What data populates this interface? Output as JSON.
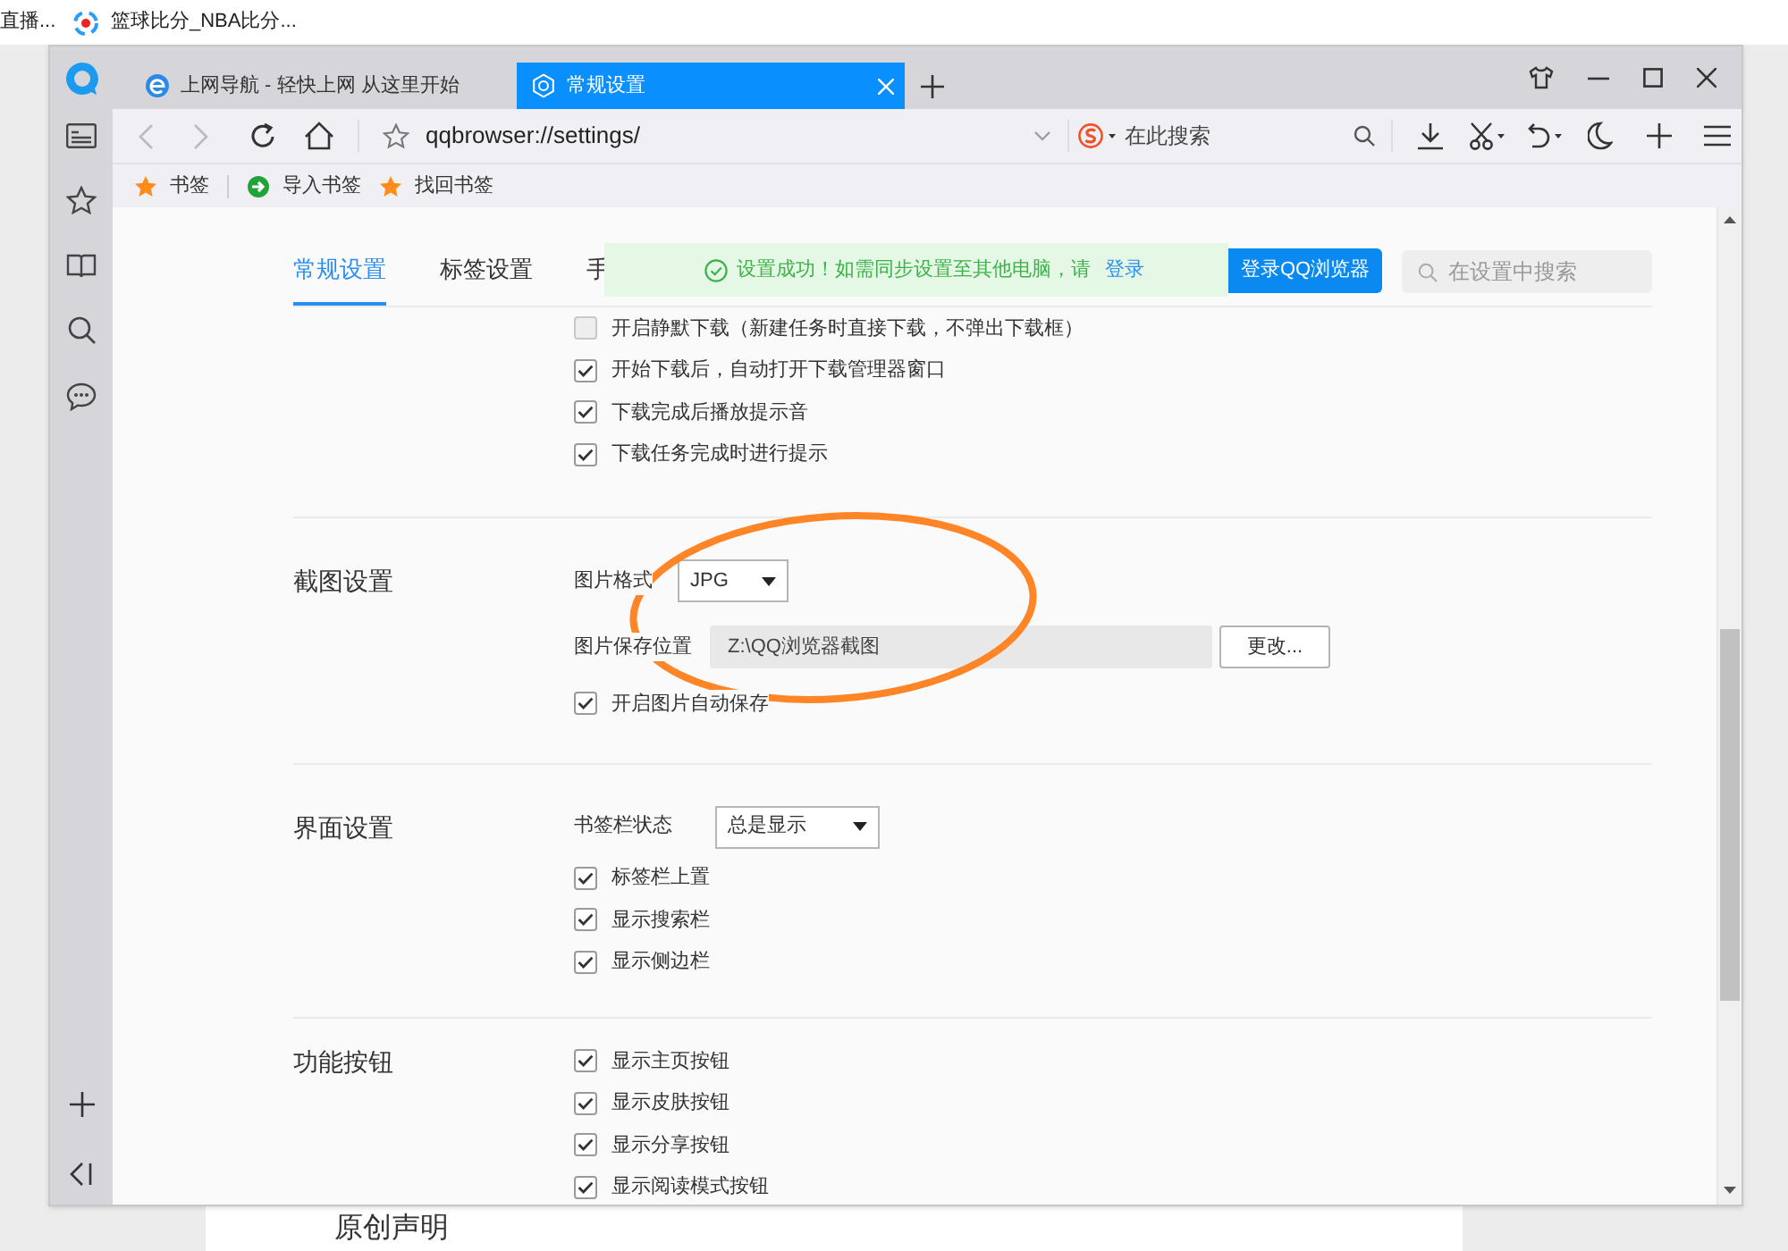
{
  "background_page": {
    "tabs": [
      {
        "title": "直播..."
      },
      {
        "title": "篮球比分_NBA比分..."
      }
    ],
    "footer_heading": "原创声明"
  },
  "browser": {
    "tabs": [
      {
        "title": "上网导航 - 轻快上网 从这里开始",
        "selected": false,
        "kind": "web"
      },
      {
        "title": "常规设置",
        "selected": true,
        "kind": "settings"
      }
    ],
    "address": "qqbrowser://settings/",
    "search_placeholder": "在此搜索",
    "bookmarks": [
      {
        "label": "书签",
        "kind": "star"
      },
      {
        "label": "导入书签",
        "kind": "import"
      },
      {
        "label": "找回书签",
        "kind": "star"
      }
    ]
  },
  "settings": {
    "tabs": [
      {
        "label": "常规设置",
        "selected": true
      },
      {
        "label": "标签设置",
        "selected": false
      },
      {
        "label": "手",
        "selected": false
      }
    ],
    "notice": {
      "text": "设置成功！如需同步设置至其他电脑，请",
      "link": "登录"
    },
    "login_button": "登录QQ浏览器",
    "search_placeholder": "在设置中搜索",
    "sections": [
      {
        "items": [
          {
            "kind": "checkbox",
            "label": "开启静默下载（新建任务时直接下载，不弹出下载框）",
            "checked": false
          },
          {
            "kind": "checkbox",
            "label": "开始下载后，自动打开下载管理器窗口",
            "checked": true
          },
          {
            "kind": "checkbox",
            "label": "下载完成后播放提示音",
            "checked": true
          },
          {
            "kind": "checkbox",
            "label": "下载任务完成时进行提示",
            "checked": true
          }
        ]
      },
      {
        "title": "截图设置",
        "items": [
          {
            "kind": "select",
            "label": "图片格式",
            "value": "JPG"
          },
          {
            "kind": "path",
            "label": "图片保存位置",
            "value": "Z:\\QQ浏览器截图",
            "button": "更改..."
          },
          {
            "kind": "checkbox",
            "label": "开启图片自动保存",
            "checked": true
          }
        ]
      },
      {
        "title": "界面设置",
        "items": [
          {
            "kind": "select",
            "label": "书签栏状态",
            "value": "总是显示"
          },
          {
            "kind": "checkbox",
            "label": "标签栏上置",
            "checked": true
          },
          {
            "kind": "checkbox",
            "label": "显示搜索栏",
            "checked": true
          },
          {
            "kind": "checkbox",
            "label": "显示侧边栏",
            "checked": true
          }
        ]
      },
      {
        "title": "功能按钮",
        "items": [
          {
            "kind": "checkbox",
            "label": "显示主页按钮",
            "checked": true
          },
          {
            "kind": "checkbox",
            "label": "显示皮肤按钮",
            "checked": true
          },
          {
            "kind": "checkbox",
            "label": "显示分享按钮",
            "checked": true
          },
          {
            "kind": "checkbox",
            "label": "显示阅读模式按钮",
            "checked": true
          }
        ]
      }
    ]
  }
}
